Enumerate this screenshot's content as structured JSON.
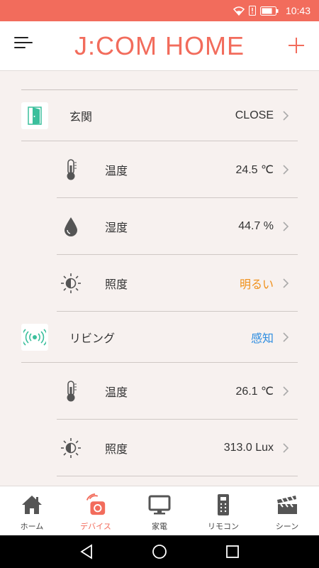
{
  "status_bar": {
    "time": "10:43",
    "color": "#f26c5c",
    "icons": [
      "wifi-icon",
      "sim-alert-icon",
      "battery-icon"
    ]
  },
  "header": {
    "title": "J:COM HOME",
    "menu_icon": "hamburger-menu-icon",
    "add_icon": "plus-icon"
  },
  "devices": [
    {
      "name": "玄関",
      "value": "CLOSE",
      "icon": "door-sensor-icon",
      "sensors": [
        {
          "label": "温度",
          "value": "24.5 ℃",
          "icon": "thermometer-icon"
        },
        {
          "label": "湿度",
          "value": "44.7 %",
          "icon": "water-drop-icon"
        },
        {
          "label": "照度",
          "value": "明るい",
          "icon": "brightness-icon",
          "value_color": "#f0901a"
        }
      ]
    },
    {
      "name": "リビング",
      "value": "感知",
      "icon": "motion-sensor-icon",
      "value_color": "#2e8de0",
      "sensors": [
        {
          "label": "温度",
          "value": "26.1 ℃",
          "icon": "thermometer-icon"
        },
        {
          "label": "照度",
          "value": "313.0 Lux",
          "icon": "brightness-icon"
        }
      ]
    }
  ],
  "tabs": [
    {
      "label": "ホーム",
      "icon": "home-icon",
      "active": false
    },
    {
      "label": "デバイス",
      "icon": "device-icon",
      "active": true
    },
    {
      "label": "家電",
      "icon": "monitor-icon",
      "active": false
    },
    {
      "label": "リモコン",
      "icon": "remote-icon",
      "active": false
    },
    {
      "label": "シーン",
      "icon": "clapperboard-icon",
      "active": false
    }
  ],
  "nav": {
    "icons": [
      "back-icon",
      "home-circle-icon",
      "recents-icon"
    ]
  },
  "colors": {
    "accent": "#f26c5c",
    "bright_orange": "#f0901a",
    "detected_blue": "#2e8de0",
    "sensor_green": "#3bbf9c"
  }
}
